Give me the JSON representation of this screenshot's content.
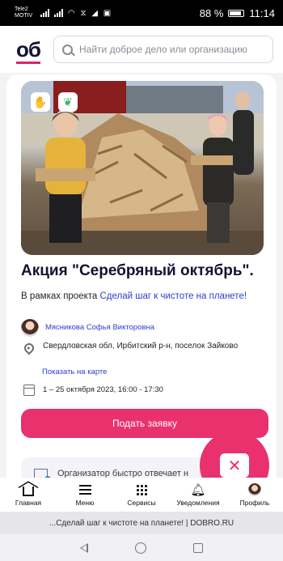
{
  "status_bar": {
    "carrier": "Tele2 MOTIV",
    "battery": "88 %",
    "time": "11:14"
  },
  "header": {
    "logo": "об",
    "search_placeholder": "Найти доброе дело или организацию"
  },
  "event": {
    "title": "Акция \"Серебряный октябрь\".",
    "project_prefix": "В рамках проекта ",
    "project_link": "Сделай шаг к чистоте на планете!",
    "organizer": "Мясникова Софья Викторовна",
    "address": "Свердловская обл, Ирбитский р-н, поселок Зайково",
    "map_link": "Показать на карте",
    "dates": "1 – 25 октября 2023, 16:00 - 17:30",
    "apply_label": "Подать заявку",
    "responds_text": "Организатор быстро отвечает н",
    "badges": [
      "hand-leaf-icon",
      "sprout-icon"
    ]
  },
  "tabs": [
    {
      "label": "Главная",
      "icon": "home-icon"
    },
    {
      "label": "Меню",
      "icon": "menu-icon"
    },
    {
      "label": "Сервисы",
      "icon": "grid-icon"
    },
    {
      "label": "Уведомления",
      "icon": "bell-icon"
    },
    {
      "label": "Профиль",
      "icon": "avatar"
    }
  ],
  "browser": {
    "url_text": "...Сделай шаг к чистоте на планете! | DOBRO.RU"
  },
  "colors": {
    "accent": "#e9316e",
    "link": "#2a3fd1",
    "logo": "#151236"
  }
}
